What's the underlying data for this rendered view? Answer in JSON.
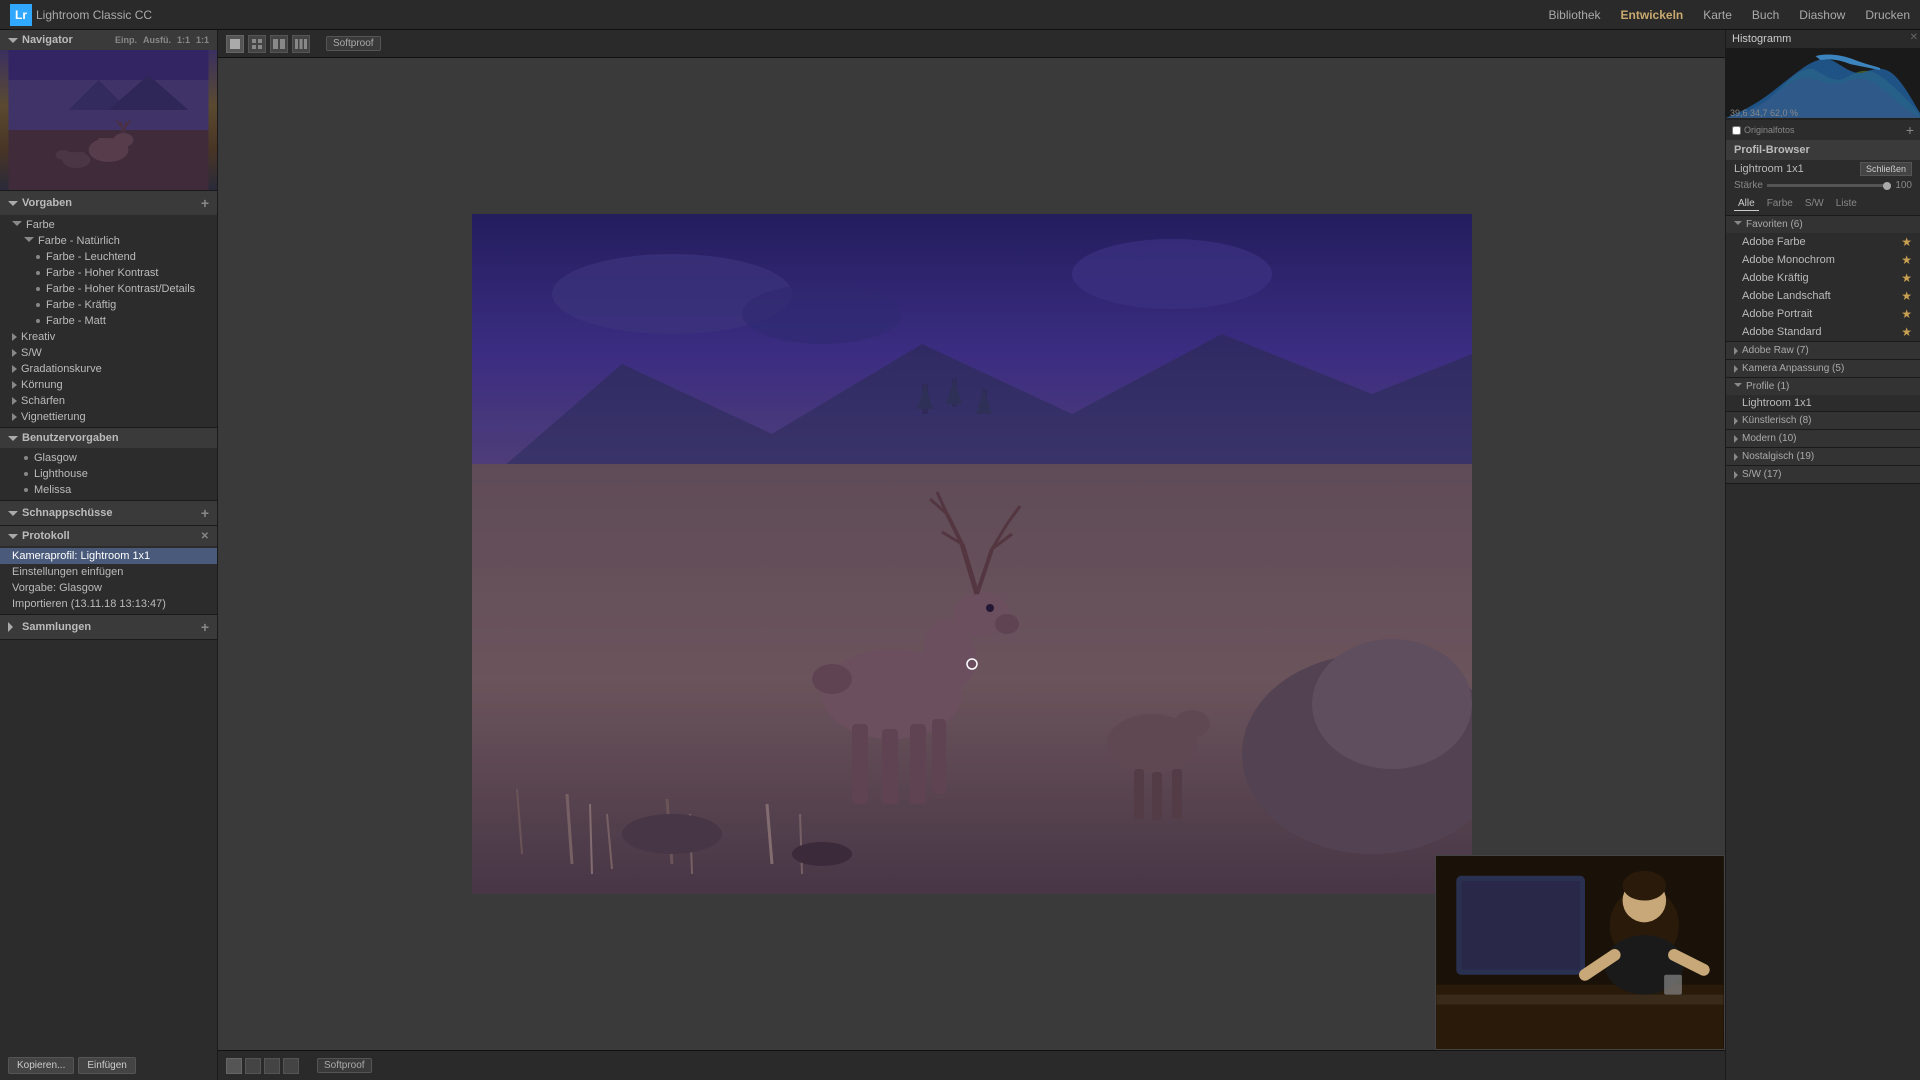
{
  "app": {
    "logo": "Lr",
    "name": "Lightroom Classic CC"
  },
  "topnav": {
    "links": [
      "Bibliothek",
      "Entwickeln",
      "Karte",
      "Buch",
      "Diashow",
      "Drucken"
    ],
    "active": "Entwickeln"
  },
  "left_panel": {
    "navigator": {
      "title": "Navigator",
      "tabs": [
        "Einp.",
        "Ausfü.",
        "1:1",
        "1:1"
      ]
    },
    "vorgaben": {
      "title": "Vorgaben",
      "sections": [
        {
          "name": "Farbe",
          "open": true,
          "children": [
            {
              "label": "Farbe - Natürlich",
              "indent": 1
            },
            {
              "label": "Farbe - Leuchtend",
              "indent": 2
            },
            {
              "label": "Farbe - Hoher Kontrast",
              "indent": 2
            },
            {
              "label": "Farbe - Hoher Kontrast/Details",
              "indent": 2
            },
            {
              "label": "Farbe - Kräftig",
              "indent": 2
            },
            {
              "label": "Farbe - Matt",
              "indent": 2
            }
          ]
        },
        {
          "name": "Kreativ",
          "open": false,
          "children": []
        },
        {
          "name": "S/W",
          "open": false,
          "children": []
        },
        {
          "name": "Gradationskurve",
          "open": false,
          "children": []
        },
        {
          "name": "Körnung",
          "open": false,
          "children": []
        },
        {
          "name": "Schärfen",
          "open": false,
          "children": []
        },
        {
          "name": "Vignettierung",
          "open": false,
          "children": []
        }
      ]
    },
    "benutzervorgaben": {
      "title": "Benutzervorgaben",
      "items": [
        "Glasgow",
        "Lighthouse",
        "Melissa"
      ]
    },
    "schnappschusse": {
      "title": "Schnappschüsse"
    },
    "protokoll": {
      "title": "Protokoll",
      "items": [
        {
          "label": "Kameraprofil: Lightroom 1x1",
          "selected": true
        },
        {
          "label": "Einstellungen einfügen"
        },
        {
          "label": "Vorgabe: Glasgow"
        },
        {
          "label": "Importieren (13.11.18 13:13:47)"
        }
      ]
    },
    "sammlungen": {
      "title": "Sammlungen"
    }
  },
  "bottom_toolbar": {
    "kopieren_label": "Kopieren...",
    "einfugen_label": "Einfügen",
    "softproof_label": "Softproof"
  },
  "right_panel": {
    "histogram_title": "Histogramm",
    "hist_values": "39,6  34,7  62,0 %",
    "originalfotos_label": "Originalfotos",
    "profile_browser_title": "Profil-Browser",
    "lightroom_profile": "Lightroom 1x1",
    "schliessen_label": "Schließen",
    "starke_label": "Stärke",
    "starke_value": "100",
    "profile_tabs": [
      "Alle",
      "Farbe",
      "S/W",
      "Liste"
    ],
    "favorites": {
      "title": "Favoriten (6)",
      "items": [
        {
          "label": "Adobe Farbe",
          "star": true
        },
        {
          "label": "Adobe Monochrom",
          "star": true
        },
        {
          "label": "Adobe Kräftig",
          "star": true
        },
        {
          "label": "Adobe Landschaft",
          "star": true
        },
        {
          "label": "Adobe Portrait",
          "star": true
        },
        {
          "label": "Adobe Standard",
          "star": true
        }
      ]
    },
    "adobe_raw": {
      "title": "Adobe Raw (7)",
      "open": false
    },
    "kamera_anpassung": {
      "title": "Kamera Anpassung (5)",
      "open": false
    },
    "profile_1": {
      "title": "Profile (1)",
      "open": true,
      "items": [
        {
          "label": "Lightroom 1x1"
        }
      ]
    },
    "kunstlerisch": {
      "title": "Künstlerisch (8)",
      "open": false
    },
    "modern": {
      "title": "Modern (10)",
      "open": false
    },
    "nostalgisch": {
      "title": "Nostalgisch (19)",
      "open": false
    },
    "sw": {
      "title": "S/W (17)",
      "open": false
    }
  }
}
